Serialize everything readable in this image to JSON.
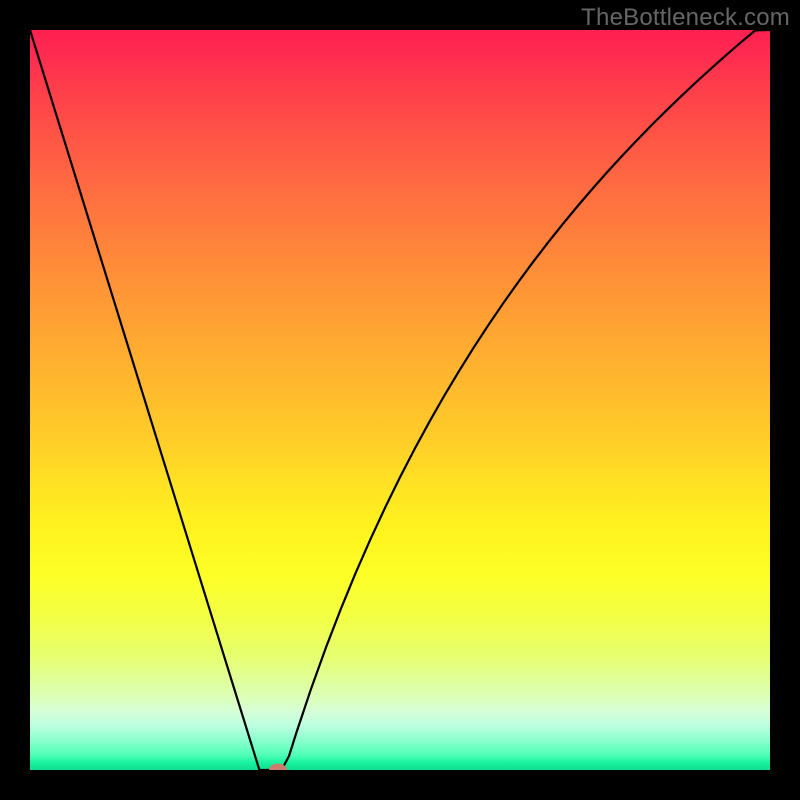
{
  "watermark": "TheBottleneck.com",
  "colors": {
    "top": "#ff1f52",
    "mid": "#ffe423",
    "bottom": "#0fde91",
    "curve": "#000000",
    "dot": "#cc7d6d",
    "frame": "#000000"
  },
  "chart_data": {
    "type": "line",
    "title": "",
    "xlabel": "",
    "ylabel": "",
    "xlim": [
      0,
      100
    ],
    "ylim": [
      0,
      100
    ],
    "x": [
      0,
      2,
      4,
      6,
      8,
      10,
      12,
      14,
      16,
      18,
      20,
      22,
      24,
      26,
      28,
      30,
      31,
      32,
      33,
      34,
      35,
      36,
      38,
      40,
      42,
      44,
      46,
      48,
      50,
      52,
      54,
      56,
      58,
      60,
      62,
      64,
      66,
      68,
      70,
      72,
      74,
      76,
      78,
      80,
      82,
      84,
      86,
      88,
      90,
      92,
      94,
      96,
      98,
      100
    ],
    "y": [
      100,
      93.55,
      87.1,
      80.65,
      74.19,
      67.74,
      61.29,
      54.84,
      48.39,
      41.94,
      35.48,
      29.03,
      22.58,
      16.13,
      9.68,
      3.23,
      0,
      0,
      0,
      0,
      1.89,
      5.05,
      11.02,
      16.57,
      21.75,
      26.61,
      31.17,
      35.48,
      39.56,
      43.43,
      47.1,
      50.61,
      53.95,
      57.15,
      60.21,
      63.15,
      65.96,
      68.67,
      71.27,
      73.78,
      76.2,
      78.53,
      80.79,
      82.97,
      85.09,
      87.14,
      89.13,
      91.06,
      92.94,
      94.76,
      96.54,
      98.27,
      99.95,
      101.59
    ],
    "minimum_marker": {
      "x": 33.5,
      "y": 0
    }
  }
}
